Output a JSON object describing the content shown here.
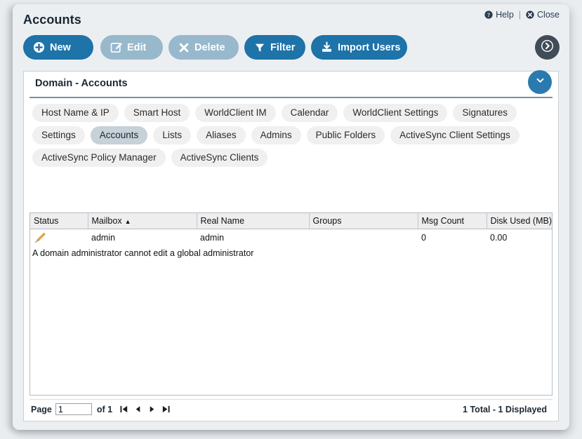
{
  "window": {
    "title": "Accounts",
    "header_links": [
      {
        "label": "Help",
        "icon": "question-circle-icon"
      },
      {
        "label": "Close",
        "icon": "close-circle-icon"
      }
    ],
    "separator": "|"
  },
  "toolbar": {
    "buttons": [
      {
        "label": "New",
        "icon": "plus-circle-icon",
        "state": "enabled"
      },
      {
        "label": "Edit",
        "icon": "pencil-square-icon",
        "state": "disabled"
      },
      {
        "label": "Delete",
        "icon": "x-mark-icon",
        "state": "disabled"
      },
      {
        "label": "Filter",
        "icon": "funnel-icon",
        "state": "enabled"
      },
      {
        "label": "Import Users",
        "icon": "download-tray-icon",
        "state": "enabled"
      }
    ],
    "expand_button_icon": "chevron-right-circle-icon"
  },
  "section": {
    "title": "Domain - Accounts",
    "collapse_icon": "chevron-down-icon"
  },
  "tabs": [
    {
      "label": "Host Name & IP",
      "active": false
    },
    {
      "label": "Smart Host",
      "active": false
    },
    {
      "label": "WorldClient IM",
      "active": false
    },
    {
      "label": "Calendar",
      "active": false
    },
    {
      "label": "WorldClient Settings",
      "active": false
    },
    {
      "label": "Signatures",
      "active": false
    },
    {
      "label": "Settings",
      "active": false
    },
    {
      "label": "Accounts",
      "active": true
    },
    {
      "label": "Lists",
      "active": false
    },
    {
      "label": "Aliases",
      "active": false
    },
    {
      "label": "Admins",
      "active": false
    },
    {
      "label": "Public Folders",
      "active": false
    },
    {
      "label": "ActiveSync Client Settings",
      "active": false
    },
    {
      "label": "ActiveSync Policy Manager",
      "active": false
    },
    {
      "label": "ActiveSync Clients",
      "active": false
    }
  ],
  "grid": {
    "columns": [
      {
        "label": "Status",
        "sort": ""
      },
      {
        "label": "Mailbox",
        "sort": "▲"
      },
      {
        "label": "Real Name",
        "sort": ""
      },
      {
        "label": "Groups",
        "sort": ""
      },
      {
        "label": "Msg Count",
        "sort": ""
      },
      {
        "label": "Disk Used (MB)",
        "sort": ""
      }
    ],
    "rows": [
      {
        "status_icon": "disabled-pencil-icon",
        "mailbox": "admin",
        "real_name": "admin",
        "groups": "",
        "msg_count": "0",
        "disk_used": "0.00"
      }
    ],
    "note": "A domain administrator cannot edit a global administrator"
  },
  "pager": {
    "page_label": "Page",
    "page_value": "1",
    "of_label": "of 1",
    "nav": [
      {
        "icon": "first-page-icon"
      },
      {
        "icon": "prev-page-icon"
      },
      {
        "icon": "next-page-icon"
      },
      {
        "icon": "last-page-icon"
      }
    ],
    "total_text": "1 Total - 1 Displayed"
  },
  "colors": {
    "accent": "#1e73a8",
    "accent_disabled": "#98b8cc",
    "dark_circle": "#414c59",
    "section_accent": "#2a7ab0",
    "tab_active": "#c6d1d8",
    "status_icon": "#e8a33d"
  }
}
